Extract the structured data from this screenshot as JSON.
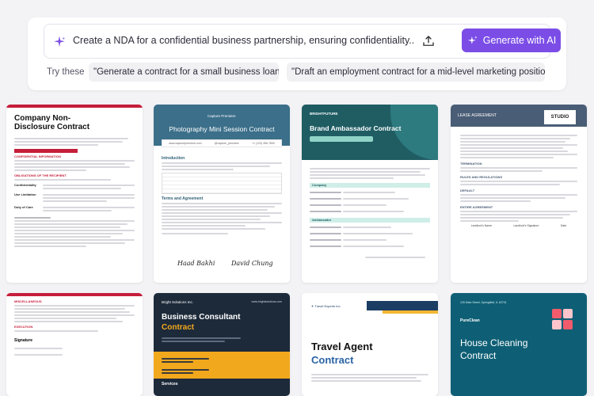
{
  "prompt": {
    "text": "Create a NDA for a confidential business partnership, ensuring confidentiality...",
    "generate_label": "Generate with AI",
    "try_label": "Try these",
    "suggestions": [
      "\"Generate a contract for a small business loan...\"",
      "\"Draft an employment contract for a mid-level marketing position...\""
    ]
  },
  "colors": {
    "accent": "#7b4de6",
    "nda_red": "#c51e3a",
    "photo_blue": "#3b6f8a",
    "brand_teal": "#1f5d63",
    "lease_slate": "#4a5d76",
    "consult_navy": "#1d2a3a",
    "consult_orange": "#f2a81d",
    "travel_blue": "#2a63a6",
    "clean_teal": "#0e5f75"
  },
  "templates": [
    {
      "title": "Company Non-Disclosure Contract",
      "section1": "CONFIDENTIAL INFORMATION",
      "section2": "OBLIGATIONS OF THE RECIPIENT",
      "rows": [
        "Confidentiality",
        "Use Limitation",
        "Duty of Care"
      ]
    },
    {
      "brand": "Capture Premiere",
      "title": "Photography Mini Session Contract",
      "strip": [
        "www.capturepremiere.com",
        "@capture_premiere",
        "+1 (123) 456-7890"
      ],
      "section1": "Introduction",
      "section2": "Terms and Agreement",
      "sig1": "Haad Bakhi",
      "sig2": "David Chung"
    },
    {
      "brand": "BRIGHTFUTURE",
      "title": "Brand Ambassador Contract",
      "section1": "Company",
      "section2": "Ambassador"
    },
    {
      "title": "LEASE AGREEMENT",
      "brand": "STUDIO",
      "sections": [
        "TERMINATION",
        "RULES AND REGULATIONS",
        "DEFAULT",
        "ENTIRE AGREEMENT"
      ],
      "signers": [
        "Landlord's Name",
        "Landlord's Signature",
        "Date"
      ]
    },
    {
      "section1": "MISCELLANEOUS",
      "section2": "EXECUTION",
      "signature": "Signature"
    },
    {
      "brand": "Bright Solutions Inc.",
      "web": "www.brightsolutions.com",
      "title1": "Business Consultant",
      "title2": "Contract",
      "section": "Services"
    },
    {
      "brand": "Travel Experts Inc.",
      "title1": "Travel Agent",
      "title2": "Contract"
    },
    {
      "address": "125 Main Street, Springfield, IL 62701",
      "brand": "PureClean",
      "title1": "House Cleaning",
      "title2": "Contract"
    }
  ]
}
